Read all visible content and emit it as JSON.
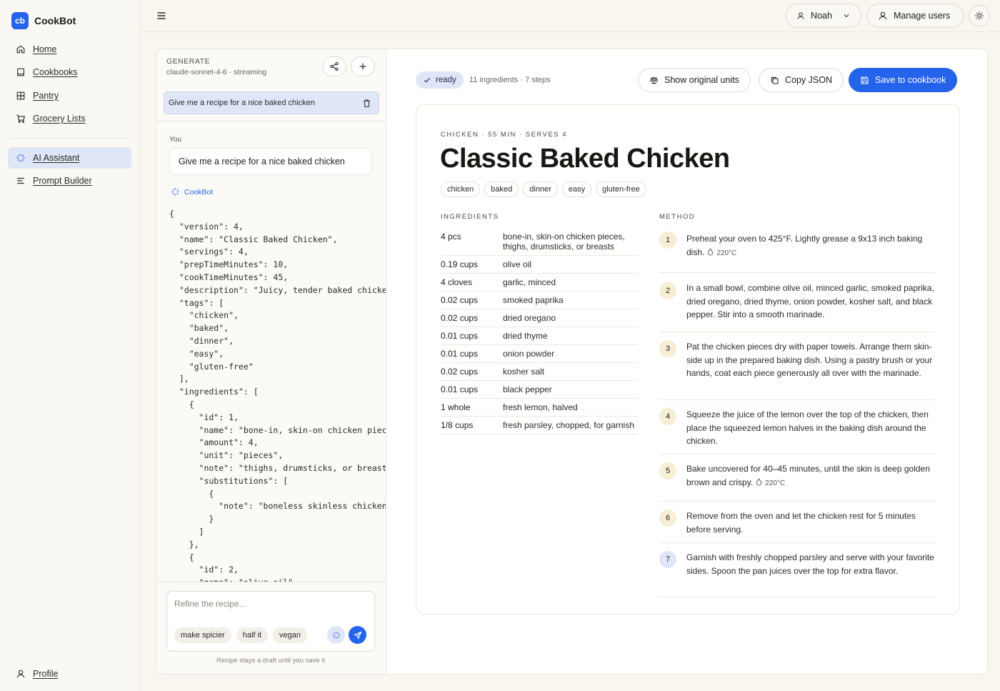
{
  "app": {
    "logo_text": "cb",
    "name": "CookBot"
  },
  "nav": {
    "items": [
      {
        "label": "Home",
        "icon": "home-icon"
      },
      {
        "label": "Cookbooks",
        "icon": "book-icon"
      },
      {
        "label": "Pantry",
        "icon": "grid-icon"
      },
      {
        "label": "Grocery Lists",
        "icon": "cart-icon"
      }
    ],
    "ai_items": [
      {
        "label": "AI Assistant",
        "icon": "sparkle-icon",
        "active": true
      },
      {
        "label": "Prompt Builder",
        "icon": "lines-icon"
      }
    ],
    "profile": "Profile"
  },
  "topbar": {
    "user_name": "Noah",
    "manage_users": "Manage users"
  },
  "chat": {
    "section_label": "GENERATE",
    "model": "claude-sonnet-4-6 · streaming",
    "active_prompt": "Give me a recipe for a nice baked chicken",
    "you_label": "You",
    "user_message": "Give me a recipe for a nice baked chicken",
    "bot_label": "CookBot",
    "code": "{\n  \"version\": 4,\n  \"name\": \"Classic Baked Chicken\",\n  \"servings\": 4,\n  \"prepTimeMinutes\": 10,\n  \"cookTimeMinutes\": 45,\n  \"description\": \"Juicy, tender baked chicken with crispy skin\",\n  \"tags\": [\n    \"chicken\",\n    \"baked\",\n    \"dinner\",\n    \"easy\",\n    \"gluten-free\"\n  ],\n  \"ingredients\": [\n    {\n      \"id\": 1,\n      \"name\": \"bone-in, skin-on chicken pieces\",\n      \"amount\": 4,\n      \"unit\": \"pieces\",\n      \"note\": \"thighs, drumsticks, or breasts\",\n      \"substitutions\": [\n        {\n          \"note\": \"boneless skinless chicken\"\n        }\n      ]\n    },\n    {\n      \"id\": 2,\n      \"name\": \"olive oil\",",
    "composer_placeholder": "Refine the recipe...",
    "suggestions": [
      "make spicier",
      "half it",
      "vegan"
    ],
    "footnote": "Recipe stays a draft until you save it"
  },
  "recipe_toolbar": {
    "status": "ready",
    "meta": "11 ingredients · 7 steps",
    "show_units": "Show original units",
    "copy_json": "Copy JSON",
    "save": "Save to cookbook"
  },
  "recipe": {
    "overline": "CHICKEN · 55 MIN · SERVES 4",
    "title": "Classic Baked Chicken",
    "tags": [
      "chicken",
      "baked",
      "dinner",
      "easy",
      "gluten-free"
    ],
    "ingredients_label": "INGREDIENTS",
    "method_label": "METHOD",
    "ingredients": [
      {
        "amount": "4 pcs",
        "name": "bone-in, skin-on chicken pieces, thighs, drumsticks, or breasts"
      },
      {
        "amount": "0.19 cups",
        "name": "olive oil"
      },
      {
        "amount": "4 cloves",
        "name": "garlic, minced"
      },
      {
        "amount": "0.02 cups",
        "name": "smoked paprika"
      },
      {
        "amount": "0.02 cups",
        "name": "dried oregano"
      },
      {
        "amount": "0.01 cups",
        "name": "dried thyme"
      },
      {
        "amount": "0.01 cups",
        "name": "onion powder"
      },
      {
        "amount": "0.02 cups",
        "name": "kosher salt"
      },
      {
        "amount": "0.01 cups",
        "name": "black pepper"
      },
      {
        "amount": "1 whole",
        "name": "fresh lemon, halved"
      },
      {
        "amount": "1/8 cups",
        "name": "fresh parsley, chopped, for garnish"
      }
    ],
    "steps": [
      {
        "num": "1",
        "text": "Preheat your oven to 425°F. Lightly grease a 9x13 inch baking dish.",
        "temp": "220°C"
      },
      {
        "num": "2",
        "text": "In a small bowl, combine olive oil, minced garlic, smoked paprika, dried oregano, dried thyme, onion powder, kosher salt, and black pepper. Stir into a smooth marinade.",
        "temp": ""
      },
      {
        "num": "3",
        "text": "Pat the chicken pieces dry with paper towels. Arrange them skin-side up in the prepared baking dish. Using a pastry brush or your hands, coat each piece generously all over with the marinade.",
        "temp": ""
      },
      {
        "num": "4",
        "text": "Squeeze the juice of the lemon over the top of the chicken, then place the squeezed lemon halves in the baking dish around the chicken.",
        "temp": ""
      },
      {
        "num": "5",
        "text": "Bake uncovered for 40–45 minutes, until the skin is deep golden brown and crispy.",
        "temp": "220°C"
      },
      {
        "num": "6",
        "text": "Remove from the oven and let the chicken rest for 5 minutes before serving.",
        "temp": ""
      },
      {
        "num": "7",
        "text": "Garnish with freshly chopped parsley and serve with your favorite sides. Spoon the pan juices over the top for extra flavor.",
        "temp": ""
      }
    ]
  },
  "colors": {
    "accent": "#2563eb",
    "active_bg": "#dfe6f7",
    "step_badge": "#f7eed6",
    "step_badge_last": "#dfe6f7"
  }
}
